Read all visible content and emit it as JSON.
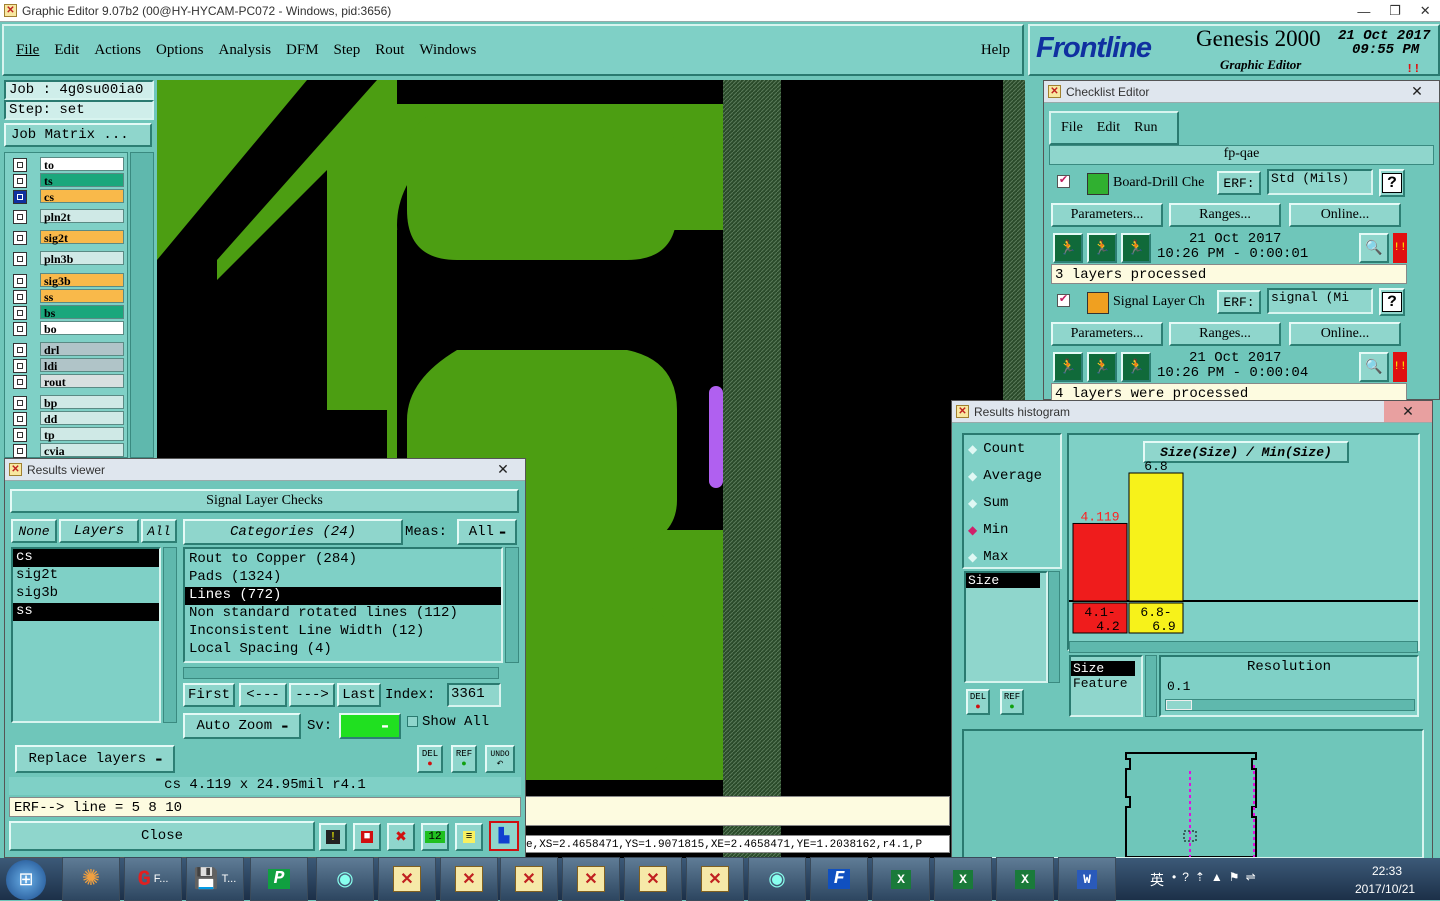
{
  "window": {
    "title": "Graphic Editor 9.07b2 (00@HY-HYCAM-PC072 - Windows, pid:3656)"
  },
  "menu": [
    "File",
    "Edit",
    "Actions",
    "Options",
    "Analysis",
    "DFM",
    "Step",
    "Rout",
    "Windows"
  ],
  "help": "Help",
  "brand": {
    "logo": "Frontline",
    "product": "Genesis 2000",
    "subtitle": "Graphic Editor",
    "date": "21 Oct 2017",
    "time": "09:55 PM"
  },
  "job": {
    "job_line": "Job : 4g0su00ia0",
    "step_line": "Step: set",
    "matrix_button": "Job Matrix ..."
  },
  "layers": [
    {
      "name": "to",
      "color": "#ffffff",
      "sel": false
    },
    {
      "name": "ts",
      "color": "#1aa77c",
      "sel": false
    },
    {
      "name": "cs",
      "color": "#f9b94a",
      "sel": true
    },
    {
      "name": "pln2t",
      "color": "#cfe9e6",
      "sel": false
    },
    {
      "name": "sig2t",
      "color": "#f9b94a",
      "sel": false
    },
    {
      "name": "pln3b",
      "color": "#cfe9e6",
      "sel": false
    },
    {
      "name": "sig3b",
      "color": "#f9b94a",
      "sel": false
    },
    {
      "name": "ss",
      "color": "#f9b94a",
      "sel": false
    },
    {
      "name": "bs",
      "color": "#1aa77c",
      "sel": false
    },
    {
      "name": "bo",
      "color": "#ffffff",
      "sel": false
    },
    {
      "name": "drl",
      "color": "#b0c4c8",
      "sel": false
    },
    {
      "name": "ldi",
      "color": "#b0c4c8",
      "sel": false
    },
    {
      "name": "rout",
      "color": "#d8e0e0",
      "sel": false
    },
    {
      "name": "bp",
      "color": "#cfe9e6",
      "sel": false
    },
    {
      "name": "dd",
      "color": "#cfe9e6",
      "sel": false
    },
    {
      "name": "tp",
      "color": "#cfe9e6",
      "sel": false
    },
    {
      "name": "cvia",
      "color": "#cfe9e6",
      "sel": false
    }
  ],
  "results": {
    "title": "Results viewer",
    "header": "Signal Layer Checks",
    "none_btn": "None",
    "layers_btn": "Layers",
    "all_btn": "All",
    "layer_list": [
      "cs",
      "sig2t",
      "sig3b",
      "ss"
    ],
    "categories_btn": "Categories (24)",
    "meas_label": "Meas:",
    "meas_value": "All",
    "categories": [
      "Rout to Copper (284)",
      "Pads (1324)",
      "Lines (772)",
      "Non standard rotated lines (112)",
      "Inconsistent Line Width (12)",
      "Local Spacing (4)"
    ],
    "first": "First",
    "prev": "<---",
    "next": "--->",
    "last": "Last",
    "index_label": "Index:",
    "index_value": "3361",
    "autozoom": "Auto Zoom",
    "sv_label": "Sv:",
    "show_all": "Show All",
    "replace": "Replace layers",
    "del": "DEL",
    "ref": "REF",
    "undo": "UNDO",
    "info": "cs 4.119 x 24.95mil  r4.1",
    "erf": "ERF--> line = 5 8 10",
    "close": "Close"
  },
  "checklist": {
    "title": "Checklist Editor",
    "menu": [
      "File",
      "Edit",
      "Run"
    ],
    "name": "fp-qae",
    "items": [
      {
        "name": "Board-Drill Che",
        "erf_label": "ERF:",
        "erf_value": "Std (Mils)",
        "params": "Parameters...",
        "ranges": "Ranges...",
        "online": "Online...",
        "date": "21 Oct 2017",
        "time": "10:26 PM - 0:00:01",
        "status": "3 layers processed"
      },
      {
        "name": "Signal Layer Ch",
        "erf_label": "ERF:",
        "erf_value": "signal (Mi",
        "params": "Parameters...",
        "ranges": "Ranges...",
        "online": "Online...",
        "date": "21 Oct 2017",
        "time": "10:26 PM - 0:00:04",
        "status": "4 layers were processed"
      }
    ]
  },
  "histogram": {
    "title": "Results histogram",
    "options": [
      "Count",
      "Average",
      "Sum",
      "Min",
      "Max"
    ],
    "selected": "Min",
    "size_item": "Size",
    "chart_title": "Size(Size) / Min(Size)",
    "res_label": "Resolution",
    "res_value": "0.1",
    "list": [
      "Size",
      "Feature"
    ],
    "del": "DEL",
    "ref": "REF"
  },
  "chart_data": {
    "type": "bar",
    "title": "Size(Size) / Min(Size)",
    "categories": [
      "4.1-4.2",
      "6.8-6.9"
    ],
    "values": [
      4.119,
      6.8
    ],
    "value_labels": [
      "4.119",
      "6.8"
    ],
    "colors": [
      "#ef1c1c",
      "#f7f21a"
    ]
  },
  "statusbar": {
    "coords": "e,XS=2.4658471,YS=1.9071815,XE=2.4658471,YE=1.2038162,r4.1,P"
  },
  "taskbar": {
    "clock": "22:33",
    "date": "2017/10/21",
    "ime": "英",
    "items": [
      "F...",
      "T..."
    ]
  }
}
